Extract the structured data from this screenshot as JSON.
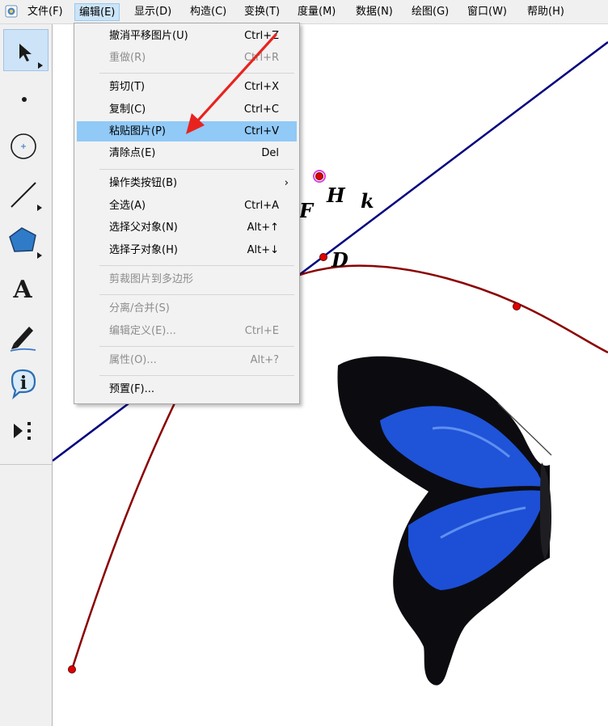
{
  "menubar": {
    "items": [
      {
        "label": "文件(F)"
      },
      {
        "label": "编辑(E)"
      },
      {
        "label": "显示(D)"
      },
      {
        "label": "构造(C)"
      },
      {
        "label": "变换(T)"
      },
      {
        "label": "度量(M)"
      },
      {
        "label": "数据(N)"
      },
      {
        "label": "绘图(G)"
      },
      {
        "label": "窗口(W)"
      },
      {
        "label": "帮助(H)"
      }
    ]
  },
  "edit_menu": {
    "items": [
      {
        "label": "撤消平移图片(U)",
        "shortcut": "Ctrl+Z",
        "enabled": true
      },
      {
        "label": "重做(R)",
        "shortcut": "Ctrl+R",
        "enabled": false
      },
      {
        "label": "剪切(T)",
        "shortcut": "Ctrl+X",
        "enabled": true
      },
      {
        "label": "复制(C)",
        "shortcut": "Ctrl+C",
        "enabled": true
      },
      {
        "label": "粘贴图片(P)",
        "shortcut": "Ctrl+V",
        "enabled": true,
        "highlighted": true
      },
      {
        "label": "清除点(E)",
        "shortcut": "Del",
        "enabled": true
      },
      {
        "label": "操作类按钮(B)",
        "submenu_arrow": "›",
        "enabled": true
      },
      {
        "label": "全选(A)",
        "shortcut": "Ctrl+A",
        "enabled": true
      },
      {
        "label": "选择父对象(N)",
        "shortcut": "Alt+↑",
        "enabled": true
      },
      {
        "label": "选择子对象(H)",
        "shortcut": "Alt+↓",
        "enabled": true
      },
      {
        "label": "剪裁图片到多边形",
        "enabled": false
      },
      {
        "label": "分离/合并(S)",
        "enabled": false
      },
      {
        "label": "编辑定义(E)...",
        "shortcut": "Ctrl+E",
        "enabled": false
      },
      {
        "label": "属性(O)...",
        "shortcut": "Alt+?",
        "enabled": false
      },
      {
        "label": "预置(F)...",
        "enabled": true
      }
    ]
  },
  "toolbox": {
    "tools": [
      {
        "name": "arrow-select-tool"
      },
      {
        "name": "point-tool"
      },
      {
        "name": "compass-tool"
      },
      {
        "name": "straightedge-tool"
      },
      {
        "name": "polygon-tool"
      },
      {
        "name": "text-tool",
        "glyph": "A"
      },
      {
        "name": "marker-tool"
      },
      {
        "name": "information-tool",
        "glyph": "i"
      },
      {
        "name": "custom-tools"
      }
    ]
  },
  "canvas": {
    "labels": {
      "H": "H",
      "k": "k",
      "F": "F",
      "D": "D"
    }
  },
  "colors": {
    "line": "#000080",
    "curve": "#8b0000",
    "point": "#e00000",
    "selected_point_ring": "#e040e0",
    "menu_highlight": "#91c9f7",
    "annotation_arrow": "#e8231f"
  }
}
